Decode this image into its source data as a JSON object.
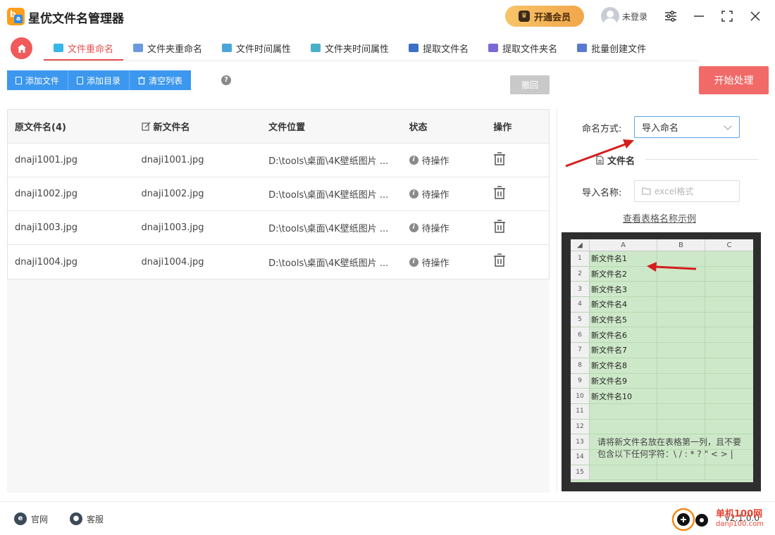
{
  "app": {
    "title": "星优文件名管理器",
    "logo_text": "b",
    "logo_sub": "a"
  },
  "header": {
    "vip_label": "开通会员",
    "login_label": "未登录"
  },
  "tabs": [
    {
      "label": "文件重命名",
      "active": true,
      "color": "#37b6e8"
    },
    {
      "label": "文件夹重命名",
      "active": false,
      "color": "#6a9be0"
    },
    {
      "label": "文件时间属性",
      "active": false,
      "color": "#4aa6d8"
    },
    {
      "label": "文件夹时间属性",
      "active": false,
      "color": "#4ab0c8"
    },
    {
      "label": "提取文件名",
      "active": false,
      "color": "#3b6fc8"
    },
    {
      "label": "提取文件夹名",
      "active": false,
      "color": "#7a6ad8"
    },
    {
      "label": "批量创建文件",
      "active": false,
      "color": "#5a7ad0"
    }
  ],
  "toolbar": {
    "add_file": "添加文件",
    "add_dir": "添加目录",
    "clear_list": "清空列表",
    "help": "?",
    "undo": "撤回",
    "start": "开始处理"
  },
  "table": {
    "headers": {
      "orig": "原文件名(4)",
      "new": "新文件名",
      "path": "文件位置",
      "status": "状态",
      "action": "操作"
    },
    "rows": [
      {
        "orig": "dnaji1001.jpg",
        "new": "dnaji1001.jpg",
        "path": "D:\\tools\\桌面\\4K壁纸图片 ...",
        "status": "待操作"
      },
      {
        "orig": "dnaji1002.jpg",
        "new": "dnaji1002.jpg",
        "path": "D:\\tools\\桌面\\4K壁纸图片 ...",
        "status": "待操作"
      },
      {
        "orig": "dnaji1003.jpg",
        "new": "dnaji1003.jpg",
        "path": "D:\\tools\\桌面\\4K壁纸图片 ...",
        "status": "待操作"
      },
      {
        "orig": "dnaji1004.jpg",
        "new": "dnaji1004.jpg",
        "path": "D:\\tools\\桌面\\4K壁纸图片 ...",
        "status": "待操作"
      }
    ]
  },
  "panel": {
    "method_label": "命名方式:",
    "method_value": "导入命名",
    "section_title": "文件名",
    "import_label": "导入名称:",
    "import_placeholder": "excel格式",
    "example_link": "查看表格名称示例"
  },
  "sheet": {
    "columns": [
      "A",
      "B",
      "C"
    ],
    "rows": [
      {
        "n": "1",
        "a": "新文件名1"
      },
      {
        "n": "2",
        "a": "新文件名2"
      },
      {
        "n": "3",
        "a": "新文件名3"
      },
      {
        "n": "4",
        "a": "新文件名4"
      },
      {
        "n": "5",
        "a": "新文件名5"
      },
      {
        "n": "6",
        "a": "新文件名6"
      },
      {
        "n": "7",
        "a": "新文件名7"
      },
      {
        "n": "8",
        "a": "新文件名8"
      },
      {
        "n": "9",
        "a": "新文件名9"
      },
      {
        "n": "10",
        "a": "新文件名10"
      },
      {
        "n": "11",
        "a": ""
      },
      {
        "n": "12",
        "a": ""
      },
      {
        "n": "13",
        "a": ""
      },
      {
        "n": "14",
        "a": ""
      },
      {
        "n": "15",
        "a": ""
      }
    ],
    "note": "请将新文件名放在表格第一列，且不要包含以下任何字符：\\ / : * ? \" < > |"
  },
  "footer": {
    "website": "官网",
    "service": "客服",
    "version": "v2.1.0.0"
  },
  "watermark": {
    "text": "单机100网",
    "url": "danji100.com"
  },
  "colors": {
    "accent": "#e8504f",
    "primary_blue": "#3c97ee",
    "start_red": "#f26a68",
    "arrow_red": "#d41e1e"
  }
}
